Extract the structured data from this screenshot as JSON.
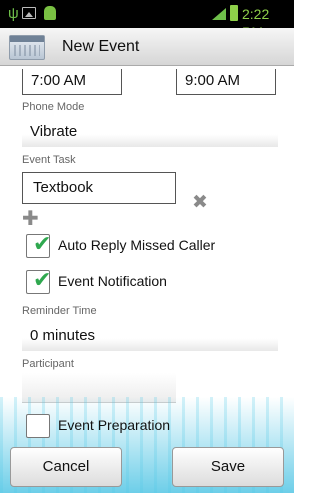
{
  "status_bar": {
    "time": "2:22 PM",
    "icons": [
      "usb-icon",
      "image-icon",
      "android-icon",
      "signal-icon",
      "battery-icon"
    ],
    "time_color": "#8fd14a"
  },
  "action_bar": {
    "title": "New Event",
    "icon": "calendar-icon"
  },
  "event_time": {
    "start": "7:00 AM",
    "end": "9:00 AM"
  },
  "phone_mode": {
    "label": "Phone Mode",
    "value": "Vibrate"
  },
  "event_task": {
    "label": "Event Task",
    "value": "Textbook"
  },
  "options": [
    {
      "label": "Auto Reply Missed Caller",
      "checked": true
    },
    {
      "label": "Event Notification",
      "checked": true
    }
  ],
  "reminder": {
    "label": "Reminder Time",
    "value": "0 minutes"
  },
  "participant": {
    "label": "Participant",
    "value": ""
  },
  "event_preparation": {
    "label": "Event Preparation",
    "checked": false
  },
  "buttons": {
    "cancel": "Cancel",
    "save": "Save"
  },
  "colors": {
    "check_green": "#2fa84f",
    "accent_cyan": "#3cbee1"
  }
}
